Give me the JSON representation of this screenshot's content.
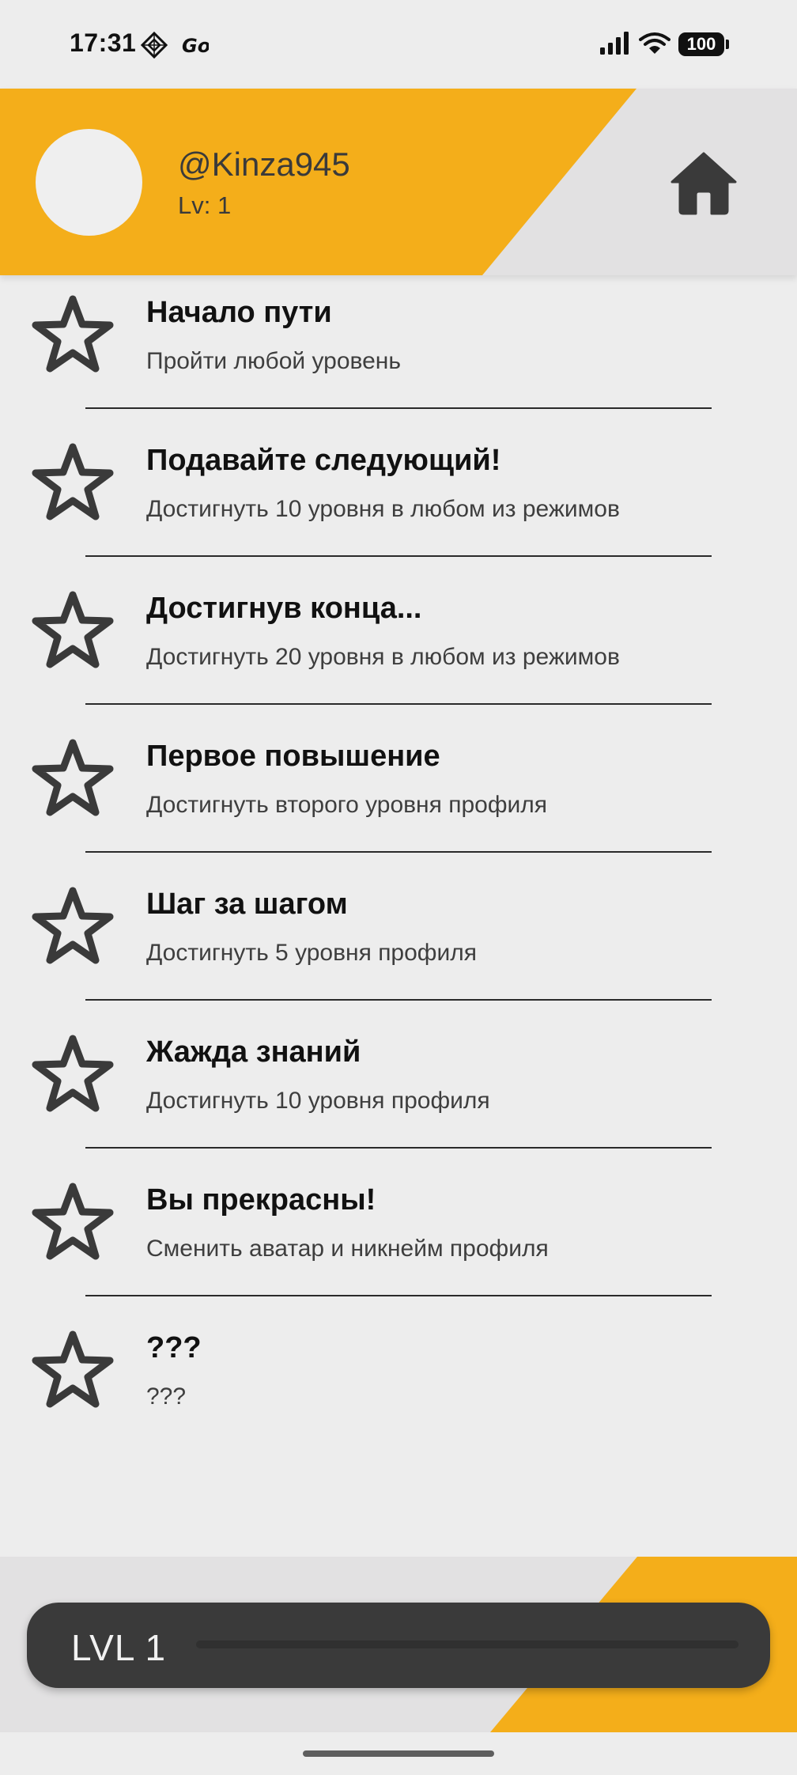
{
  "status_bar": {
    "time": "17:31",
    "battery": "100",
    "icons": [
      "notification-app-icon",
      "go-app-icon",
      "signal-icon",
      "wifi-icon",
      "battery-icon"
    ]
  },
  "header": {
    "username": "@Kinza945",
    "level": "Lv: 1",
    "home_icon": "home-icon"
  },
  "achievements": [
    {
      "title": "Начало пути",
      "description": "Пройти любой уровень",
      "icon": "star-outline-icon"
    },
    {
      "title": "Подавайте следующий!",
      "description": "Достигнуть 10 уровня в любом из режимов",
      "icon": "star-outline-icon"
    },
    {
      "title": "Достигнув конца...",
      "description": "Достигнуть 20 уровня в любом из режимов",
      "icon": "star-outline-icon"
    },
    {
      "title": "Первое повышение",
      "description": "Достигнуть второго уровня профиля",
      "icon": "star-outline-icon"
    },
    {
      "title": "Шаг за шагом",
      "description": "Достигнуть 5 уровня профиля",
      "icon": "star-outline-icon"
    },
    {
      "title": "Жажда знаний",
      "description": "Достигнуть 10 уровня профиля",
      "icon": "star-outline-icon"
    },
    {
      "title": "Вы прекрасны!",
      "description": "Сменить аватар и никнейм профиля",
      "icon": "star-outline-icon"
    },
    {
      "title": "???",
      "description": "???",
      "icon": "star-outline-icon"
    }
  ],
  "level_bar": {
    "label": "LVL 1",
    "progress": 0
  },
  "colors": {
    "accent": "#f4ae1a",
    "header_bg": "#e2e1e2",
    "page_bg": "#ededed",
    "dark": "#3a3a3a"
  }
}
